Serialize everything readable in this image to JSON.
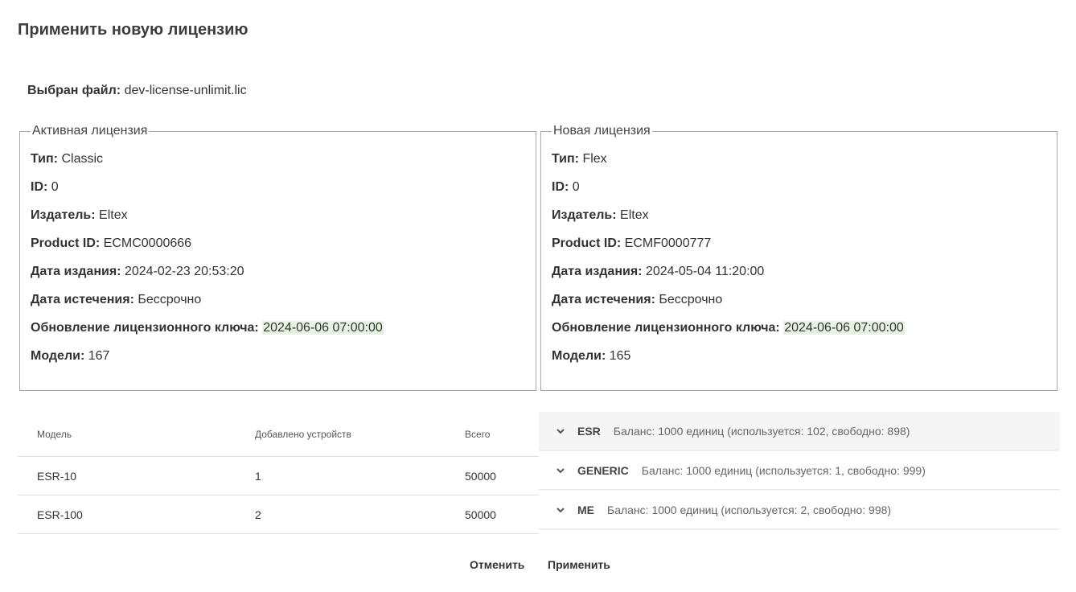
{
  "dialog": {
    "title": "Применить новую лицензию"
  },
  "file": {
    "label": "Выбран файл:",
    "value": "dev-license-unlimit.lic"
  },
  "active_license": {
    "legend": "Активная лицензия",
    "fields": [
      {
        "label": "Тип:",
        "value": "Classic"
      },
      {
        "label": "ID:",
        "value": "0"
      },
      {
        "label": "Издатель:",
        "value": "Eltex"
      },
      {
        "label": "Product ID:",
        "value": "ECMC0000666"
      },
      {
        "label": "Дата издания:",
        "value": "2024-02-23 20:53:20"
      },
      {
        "label": "Дата истечения:",
        "value": "Бессрочно"
      },
      {
        "label": "Обновление лицензионного ключа:",
        "value": "2024-06-06 07:00:00"
      },
      {
        "label": "Модели:",
        "value": "167"
      }
    ]
  },
  "new_license": {
    "legend": "Новая лицензия",
    "fields": [
      {
        "label": "Тип:",
        "value": "Flex"
      },
      {
        "label": "ID:",
        "value": "0"
      },
      {
        "label": "Издатель:",
        "value": "Eltex"
      },
      {
        "label": "Product ID:",
        "value": "ECMF0000777"
      },
      {
        "label": "Дата издания:",
        "value": "2024-05-04 11:20:00"
      },
      {
        "label": "Дата истечения:",
        "value": "Бессрочно"
      },
      {
        "label": "Обновление лицензионного ключа:",
        "value": "2024-06-06 07:00:00"
      },
      {
        "label": "Модели:",
        "value": "165"
      }
    ]
  },
  "models_table": {
    "columns": [
      "Модель",
      "Добавлено устройств",
      "Всего"
    ],
    "rows": [
      [
        "ESR-10",
        "1",
        "50000"
      ],
      [
        "ESR-100",
        "2",
        "50000"
      ]
    ]
  },
  "groups": [
    {
      "name": "ESR",
      "balance": "Баланс: 1000 единиц (используется: 102, свободно: 898)"
    },
    {
      "name": "GENERIC",
      "balance": "Баланс: 1000 единиц (используется: 1, свободно: 999)"
    },
    {
      "name": "ME",
      "balance": "Баланс: 1000 единиц (используется: 2, свободно: 998)"
    }
  ],
  "actions": {
    "cancel": "Отменить",
    "apply": "Применить"
  },
  "colors": {
    "highlight": "#e6f3e2",
    "border": "#a8a8a8"
  },
  "icons": {
    "group_toggle": "chevron-down-icon"
  }
}
